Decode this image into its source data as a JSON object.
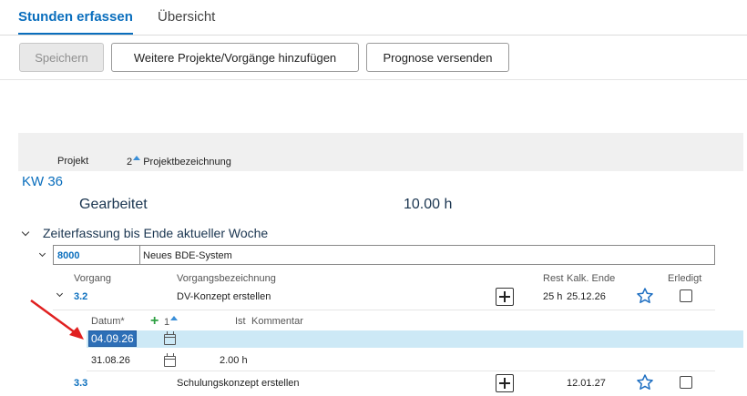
{
  "tabs": [
    {
      "label": "Stunden erfassen",
      "active": true
    },
    {
      "label": "Übersicht",
      "active": false
    }
  ],
  "toolbar": {
    "save_label": "Speichern",
    "add_label": "Weitere Projekte/Vorgänge hinzufügen",
    "forecast_label": "Prognose versenden"
  },
  "columns": {
    "projekt": "Projekt",
    "sort_num": "2",
    "bezeichnung": "Projektbezeichnung"
  },
  "week": {
    "title": "KW 36",
    "worked_label": "Gearbeitet",
    "worked_value": "10.00 h"
  },
  "section": {
    "title": "Zeiterfassung bis Ende aktueller Woche"
  },
  "project": {
    "number": "8000",
    "name": "Neues BDE-System"
  },
  "vorgang_header": {
    "vorgang": "Vorgang",
    "bezeichnung": "Vorgangsbezeichnung",
    "rest": "Rest",
    "kalk_ende": "Kalk. Ende",
    "erledigt": "Erledigt"
  },
  "vorgaenge": [
    {
      "id": "3.2",
      "name": "DV-Konzept erstellen",
      "rest": "25 h",
      "kalk_ende": "25.12.26"
    },
    {
      "id": "3.3",
      "name": "Schulungskonzept erstellen",
      "rest": "",
      "kalk_ende": "12.01.27"
    }
  ],
  "entry_header": {
    "datum": "Datum*",
    "sort_num": "1",
    "ist": "Ist",
    "kommentar": "Kommentar"
  },
  "entries": [
    {
      "datum": "04.09.26",
      "ist": ""
    },
    {
      "datum": "31.08.26",
      "ist": "2.00 h"
    }
  ],
  "colors": {
    "accent": "#0a6ebd",
    "selection": "#cde9f6",
    "annotation_arrow": "#e02020"
  }
}
